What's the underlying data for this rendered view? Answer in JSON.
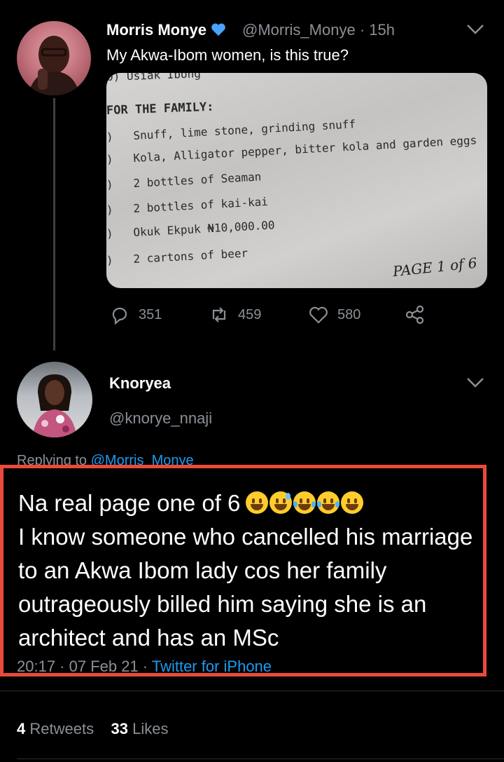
{
  "parent_tweet": {
    "display_name": "Morris Monye",
    "verified_emoji": "💙",
    "handle": "@Morris_Monye",
    "time_sep": "·",
    "time": "15h",
    "text": "My Akwa-Ibom women, is this true?",
    "image": {
      "top_cut": "0) Usiak Ibong",
      "heading": "FOR THE FAMILY:",
      "items": [
        {
          "num": ")",
          "text": "Snuff, lime stone, grinding snuff"
        },
        {
          "num": ")",
          "text": "Kola, Alligator pepper, bitter kola and garden eggs"
        },
        {
          "num": ")",
          "text": "2 bottles of Seaman"
        },
        {
          "num": ")",
          "text": "2 bottles of kai-kai"
        },
        {
          "num": ")",
          "text": "Okuk Ekpuk ₦10,000.00"
        },
        {
          "num": ")",
          "text": "2 cartons of beer"
        }
      ],
      "page_note": "PAGE 1 of 6"
    },
    "actions": {
      "replies": "351",
      "retweets": "459",
      "likes": "580"
    }
  },
  "reply_tweet": {
    "display_name": "Knoryea",
    "handle": "@knorye_nnaji",
    "replying_prefix": "Replying to ",
    "replying_to": "@Morris_Monye",
    "text_line1": "Na real page one of 6",
    "text_rest": "I know someone who cancelled his marriage to an Akwa Ibom lady cos her family outrageously billed him saying she is an architect and has an MSc",
    "timestamp": "20:17 · 07 Feb 21 · ",
    "source": "Twitter for iPhone",
    "retweet_count": "4",
    "retweet_label": " Retweets",
    "like_count": "33",
    "like_label": " Likes"
  },
  "colors": {
    "background": "#000000",
    "secondary_text": "#8b9096",
    "link": "#1d9bf0",
    "highlight_box": "#ea4a3a"
  }
}
